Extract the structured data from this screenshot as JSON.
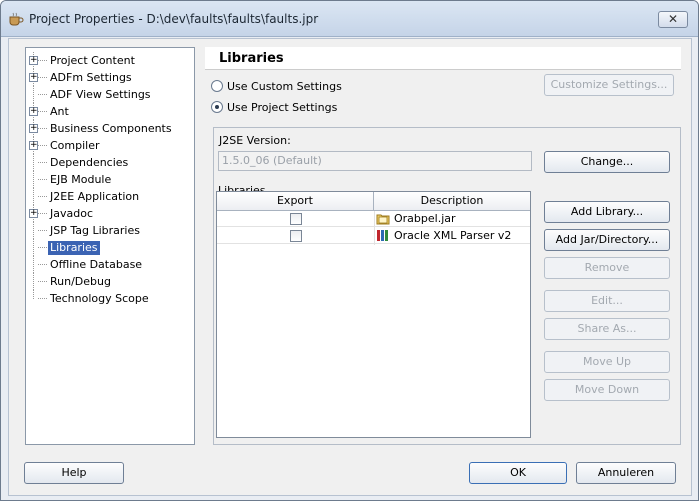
{
  "window": {
    "title": "Project Properties - D:\\dev\\faults\\faults\\faults.jpr",
    "close_label": "✕"
  },
  "tree": {
    "items": [
      {
        "label": "Project Content",
        "expandable": true
      },
      {
        "label": "ADFm Settings",
        "expandable": true
      },
      {
        "label": "ADF View Settings",
        "expandable": false
      },
      {
        "label": "Ant",
        "expandable": true
      },
      {
        "label": "Business Components",
        "expandable": true
      },
      {
        "label": "Compiler",
        "expandable": true
      },
      {
        "label": "Dependencies",
        "expandable": false
      },
      {
        "label": "EJB Module",
        "expandable": false
      },
      {
        "label": "J2EE Application",
        "expandable": false
      },
      {
        "label": "Javadoc",
        "expandable": true
      },
      {
        "label": "JSP Tag Libraries",
        "expandable": false
      },
      {
        "label": "Libraries",
        "expandable": false,
        "selected": true
      },
      {
        "label": "Offline Database",
        "expandable": false
      },
      {
        "label": "Run/Debug",
        "expandable": false
      },
      {
        "label": "Technology Scope",
        "expandable": false
      }
    ]
  },
  "panel": {
    "title": "Libraries",
    "radio_custom": "Use Custom Settings",
    "radio_project": "Use Project Settings",
    "customize_button": "Customize Settings...",
    "j2se_label": "J2SE Version:",
    "j2se_value": "1.5.0_06 (Default)",
    "change_button": "Change...",
    "libraries_label": "Libraries",
    "table": {
      "headers": [
        "Export",
        "Description"
      ],
      "rows": [
        {
          "export": false,
          "description": "Orabpel.jar",
          "icon": "jar-folder-icon"
        },
        {
          "export": false,
          "description": "Oracle XML Parser v2",
          "icon": "library-books-icon"
        }
      ]
    },
    "buttons": {
      "add_library": "Add Library...",
      "add_jar": "Add Jar/Directory...",
      "remove": "Remove",
      "edit": "Edit...",
      "share_as": "Share As...",
      "move_up": "Move Up",
      "move_down": "Move Down"
    }
  },
  "footer": {
    "help": "Help",
    "ok": "OK",
    "cancel": "Annuleren"
  }
}
